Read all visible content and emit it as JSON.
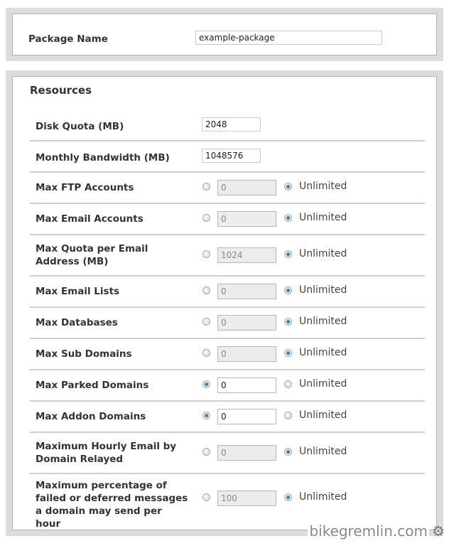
{
  "package": {
    "label": "Package Name",
    "value": "example-package"
  },
  "resources": {
    "title": "Resources",
    "disk_quota": {
      "label": "Disk Quota (MB)",
      "value": "2048"
    },
    "bandwidth": {
      "label": "Monthly Bandwidth (MB)",
      "value": "1048576"
    },
    "unlimited_label": "Unlimited",
    "rows": [
      {
        "label": "Max FTP Accounts",
        "value": "0",
        "unlimited": true
      },
      {
        "label": "Max Email Accounts",
        "value": "0",
        "unlimited": true
      },
      {
        "label": "Max Quota per Email Address (MB)",
        "value": "1024",
        "unlimited": true
      },
      {
        "label": "Max Email Lists",
        "value": "0",
        "unlimited": true
      },
      {
        "label": "Max Databases",
        "value": "0",
        "unlimited": true
      },
      {
        "label": "Max Sub Domains",
        "value": "0",
        "unlimited": true
      },
      {
        "label": "Max Parked Domains",
        "value": "0",
        "unlimited": false
      },
      {
        "label": "Max Addon Domains",
        "value": "0",
        "unlimited": false
      },
      {
        "label": "Maximum Hourly Email by Domain Relayed",
        "value": "0",
        "unlimited": true
      },
      {
        "label": "Maximum percentage of failed or deferred messages a domain may send per hour",
        "value": "100",
        "unlimited": true
      }
    ]
  },
  "watermark": {
    "text": "bikegremlin.com",
    "icon": "gear-icon"
  }
}
